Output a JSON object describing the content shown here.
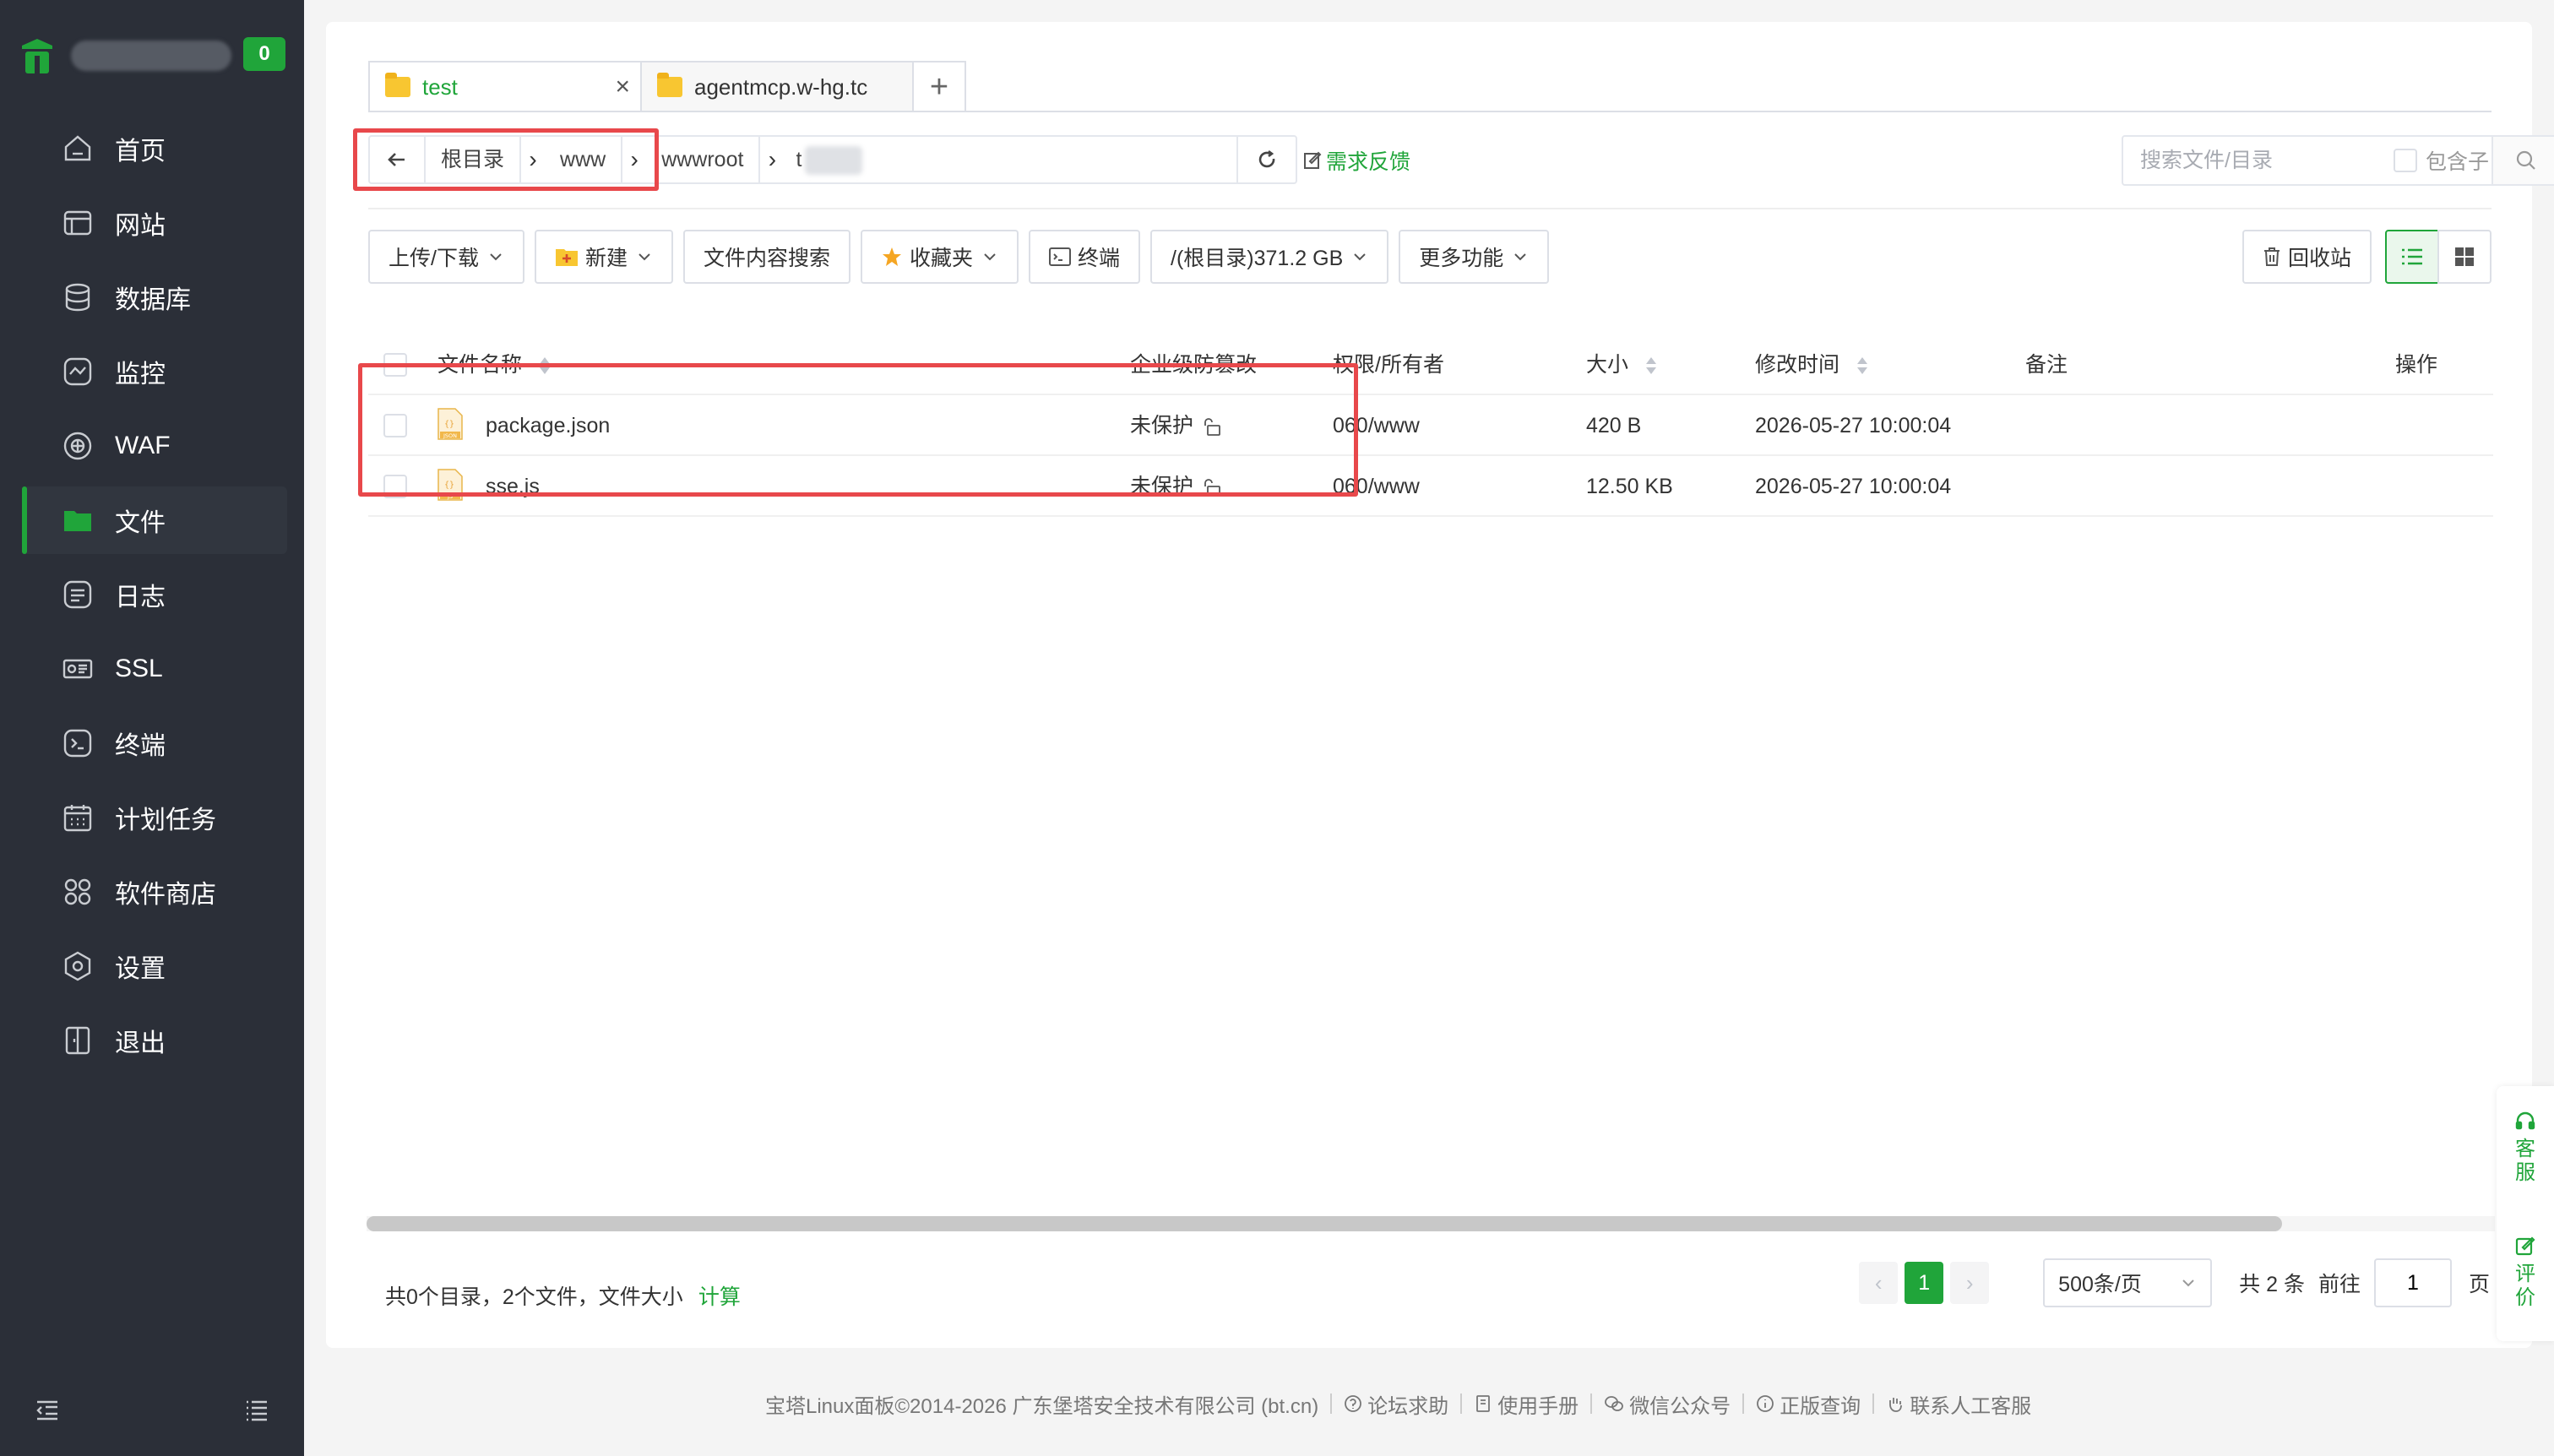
{
  "sidebar": {
    "badge": "0",
    "items": [
      {
        "label": "首页",
        "icon": "home-icon"
      },
      {
        "label": "网站",
        "icon": "website-icon"
      },
      {
        "label": "数据库",
        "icon": "database-icon"
      },
      {
        "label": "监控",
        "icon": "monitor-icon"
      },
      {
        "label": "WAF",
        "icon": "waf-shield-icon"
      },
      {
        "label": "文件",
        "icon": "folder-icon"
      },
      {
        "label": "日志",
        "icon": "log-icon"
      },
      {
        "label": "SSL",
        "icon": "ssl-icon"
      },
      {
        "label": "终端",
        "icon": "terminal-icon"
      },
      {
        "label": "计划任务",
        "icon": "calendar-icon"
      },
      {
        "label": "软件商店",
        "icon": "app-store-icon"
      },
      {
        "label": "设置",
        "icon": "settings-icon"
      },
      {
        "label": "退出",
        "icon": "logout-icon"
      }
    ],
    "active_index": 5
  },
  "tabs": [
    {
      "label": "test",
      "active": true
    },
    {
      "label": "agentmcp.w-hg.tc",
      "active": false
    }
  ],
  "address": {
    "crumbs": [
      "根目录",
      "www",
      "wwwroot"
    ],
    "last_crumb": "t"
  },
  "feedback_label": "需求反馈",
  "search": {
    "placeholder": "搜索文件/目录",
    "include_sub_label": "包含子目录"
  },
  "toolbar": {
    "upload_download": "上传/下载",
    "new": "新建",
    "content_search": "文件内容搜索",
    "favorites": "收藏夹",
    "terminal": "终端",
    "disk": "/(根目录)371.2 GB",
    "more": "更多功能",
    "recycle_bin": "回收站"
  },
  "table": {
    "headers": {
      "name": "文件名称",
      "protect": "企业级防篡改",
      "perm": "权限/所有者",
      "size": "大小",
      "mtime": "修改时间",
      "note": "备注",
      "action": "操作"
    },
    "rows": [
      {
        "name": "package.json",
        "type_label": "JSON",
        "protect": "未保护",
        "perm": "060/www",
        "size": "420 B",
        "mtime": "2026-05-27 10:00:04",
        "note": ""
      },
      {
        "name": "sse.js",
        "type_label": "JS",
        "protect": "未保护",
        "perm": "060/www",
        "size": "12.50 KB",
        "mtime": "2026-05-27 10:00:04",
        "note": ""
      }
    ]
  },
  "summary": {
    "text": "共0个目录，2个文件，文件大小",
    "calc": "计算"
  },
  "pager": {
    "current": "1",
    "page_size": "500条/页",
    "total": "共 2 条",
    "goto": "前往",
    "goto_value": "1",
    "unit": "页"
  },
  "float": {
    "service": [
      "客",
      "服"
    ],
    "review": [
      "评",
      "价"
    ]
  },
  "footer": {
    "copyright": "宝塔Linux面板©2014-2026 广东堡塔安全技术有限公司 (bt.cn)",
    "links": [
      "论坛求助",
      "使用手册",
      "微信公众号",
      "正版查询",
      "联系人工客服"
    ]
  },
  "colors": {
    "accent": "#20a53a",
    "sidebar_bg": "#2b2f38",
    "highlight_box": "#e8484b"
  }
}
